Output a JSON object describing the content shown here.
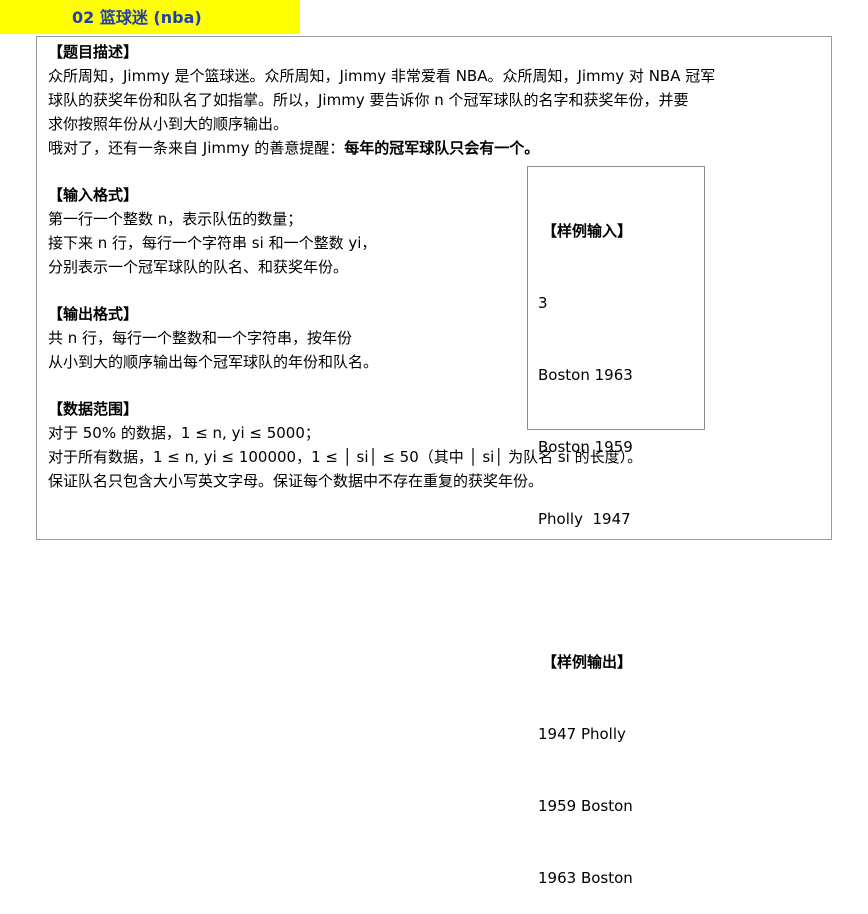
{
  "title": "02 篮球迷 (nba)",
  "description": {
    "heading": "【题目描述】",
    "lines": [
      "众所周知，Jimmy 是个篮球迷。众所周知，Jimmy 非常爱看 NBA。众所周知，Jimmy 对 NBA 冠军",
      "球队的获奖年份和队名了如指掌。所以，Jimmy 要告诉你 n 个冠军球队的名字和获奖年份，并要",
      "求你按照年份从小到大的顺序输出。"
    ],
    "reminder_prefix": "哦对了，还有一条来自 Jimmy 的善意提醒：",
    "reminder_bold": "每年的冠军球队只会有一个。"
  },
  "input_format": {
    "heading": "【输入格式】",
    "lines": [
      "第一行一个整数 n，表示队伍的数量；",
      "接下来 n 行，每行一个字符串 si 和一个整数 yi，",
      "分别表示一个冠军球队的队名、和获奖年份。"
    ]
  },
  "output_format": {
    "heading": "【输出格式】",
    "lines": [
      "共 n 行，每行一个整数和一个字符串，按年份",
      "从小到大的顺序输出每个冠军球队的年份和队名。"
    ]
  },
  "data_range": {
    "heading": "【数据范围】",
    "lines": [
      "对于 50% 的数据，1 ≤ n, yi ≤ 5000；",
      "对于所有数据，1 ≤ n, yi ≤ 100000，1 ≤ │ si│ ≤ 50（其中 │ si│ 为队名 si 的长度）。",
      "保证队名只包含大小写英文字母。保证每个数据中不存在重复的获奖年份。"
    ]
  },
  "sample": {
    "input_heading": "【样例输入】",
    "input_lines": [
      "3",
      "Boston 1963",
      "Boston 1959",
      "Pholly  1947"
    ],
    "output_heading": "【样例输出】",
    "output_lines": [
      "1947 Pholly",
      "1959 Boston",
      "1963 Boston"
    ]
  }
}
